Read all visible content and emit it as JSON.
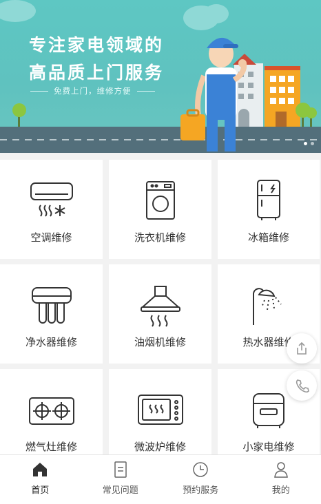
{
  "banner": {
    "line1": "专注家电领域的",
    "line2": "高品质上门服务",
    "subtitle": "免费上门，维修方便",
    "slides": 2
  },
  "services": [
    {
      "label": "空调维修",
      "icon": "air-conditioner-icon"
    },
    {
      "label": "洗衣机维修",
      "icon": "washing-machine-icon"
    },
    {
      "label": "冰箱维修",
      "icon": "refrigerator-icon"
    },
    {
      "label": "净水器维修",
      "icon": "water-purifier-icon"
    },
    {
      "label": "油烟机维修",
      "icon": "range-hood-icon"
    },
    {
      "label": "热水器维修",
      "icon": "water-heater-icon"
    },
    {
      "label": "燃气灶维修",
      "icon": "gas-stove-icon"
    },
    {
      "label": "微波炉维修",
      "icon": "microwave-icon"
    },
    {
      "label": "小家电维修",
      "icon": "small-appliance-icon"
    }
  ],
  "floating": {
    "share_icon": "share-icon",
    "phone_icon": "phone-icon"
  },
  "tabs": [
    {
      "label": "首页",
      "icon": "home-icon",
      "active": true
    },
    {
      "label": "常见问题",
      "icon": "document-icon",
      "active": false
    },
    {
      "label": "预约服务",
      "icon": "clock-icon",
      "active": false
    },
    {
      "label": "我的",
      "icon": "user-icon",
      "active": false
    }
  ],
  "colors": {
    "banner": "#5ec7c3",
    "road": "#4f6f7a",
    "worker_blue": "#3b82d6",
    "building_orange": "#f5a623"
  }
}
